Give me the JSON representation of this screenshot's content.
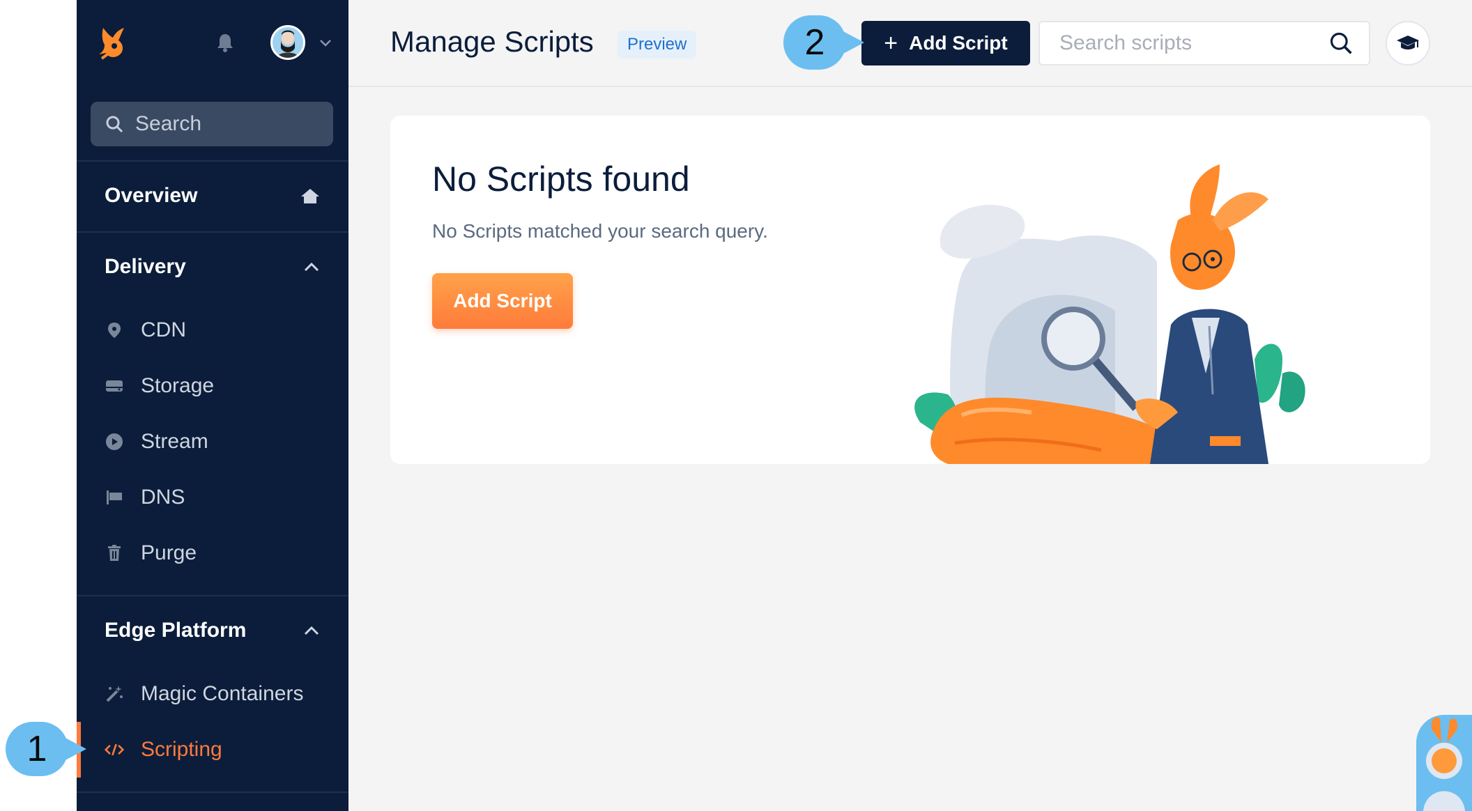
{
  "sidebar": {
    "search_label": "Search",
    "sections": [
      {
        "label": "Overview"
      },
      {
        "label": "Delivery",
        "items": [
          {
            "label": "CDN",
            "icon": "map-pin-icon"
          },
          {
            "label": "Storage",
            "icon": "storage-icon"
          },
          {
            "label": "Stream",
            "icon": "play-icon"
          },
          {
            "label": "DNS",
            "icon": "flag-icon"
          },
          {
            "label": "Purge",
            "icon": "trash-icon"
          }
        ]
      },
      {
        "label": "Edge Platform",
        "items": [
          {
            "label": "Magic Containers",
            "icon": "magic-wand-icon"
          },
          {
            "label": "Scripting",
            "icon": "code-icon",
            "active": true
          }
        ]
      }
    ],
    "accent_color": "#ff7a3d",
    "background_color": "#0b1d3a"
  },
  "header": {
    "title": "Manage Scripts",
    "badge": "Preview",
    "add_button_label": "Add Script",
    "search_placeholder": "Search scripts"
  },
  "empty_state": {
    "title": "No Scripts found",
    "message": "No Scripts matched your search query.",
    "button_label": "Add Script"
  },
  "annotations": {
    "marker_1": "1",
    "marker_2": "2"
  }
}
